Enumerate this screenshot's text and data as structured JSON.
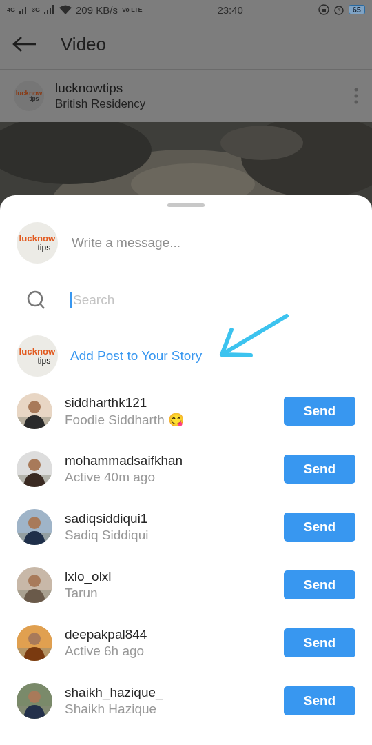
{
  "status_bar": {
    "network_1": "4G",
    "network_2": "3G",
    "speed": "209 KB/s",
    "volte": "Vo LTE",
    "time": "23:40",
    "battery": "65"
  },
  "header": {
    "title": "Video"
  },
  "post": {
    "avatar_top": "lucknow",
    "avatar_bottom": "tips",
    "username": "lucknowtips",
    "location": "British Residency"
  },
  "share_sheet": {
    "avatar_top": "lucknow",
    "avatar_bottom": "tips",
    "message_placeholder": "Write a message...",
    "search_placeholder": "Search",
    "story_avatar_top": "lucknow",
    "story_avatar_bottom": "tips",
    "story_action": "Add Post to Your Story"
  },
  "contacts": [
    {
      "username": "siddharthk121",
      "subtitle": "Foodie Siddharth 😋",
      "button": "Send"
    },
    {
      "username": "mohammadsaifkhan",
      "subtitle": "Active 40m ago",
      "button": "Send"
    },
    {
      "username": "sadiqsiddiqui1",
      "subtitle": "Sadiq Siddiqui",
      "button": "Send"
    },
    {
      "username": "lxlo_olxl",
      "subtitle": "Tarun",
      "button": "Send"
    },
    {
      "username": "deepakpal844",
      "subtitle": "Active 6h ago",
      "button": "Send"
    },
    {
      "username": "shaikh_hazique_",
      "subtitle": "Shaikh Hazique",
      "button": "Send"
    }
  ]
}
